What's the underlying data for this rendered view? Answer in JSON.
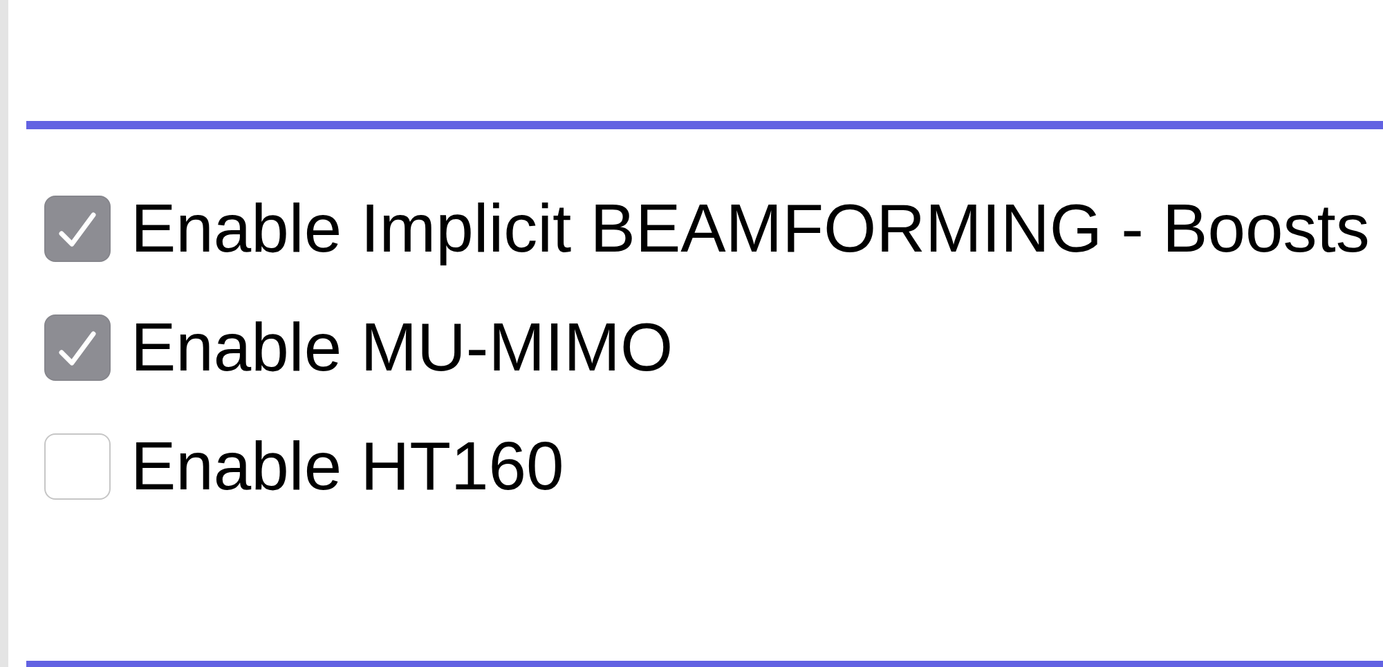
{
  "options": [
    {
      "label": "Enable Implicit BEAMFORMING - Boosts",
      "checked": true
    },
    {
      "label": "Enable MU-MIMO",
      "checked": true
    },
    {
      "label": "Enable HT160",
      "checked": false
    }
  ]
}
